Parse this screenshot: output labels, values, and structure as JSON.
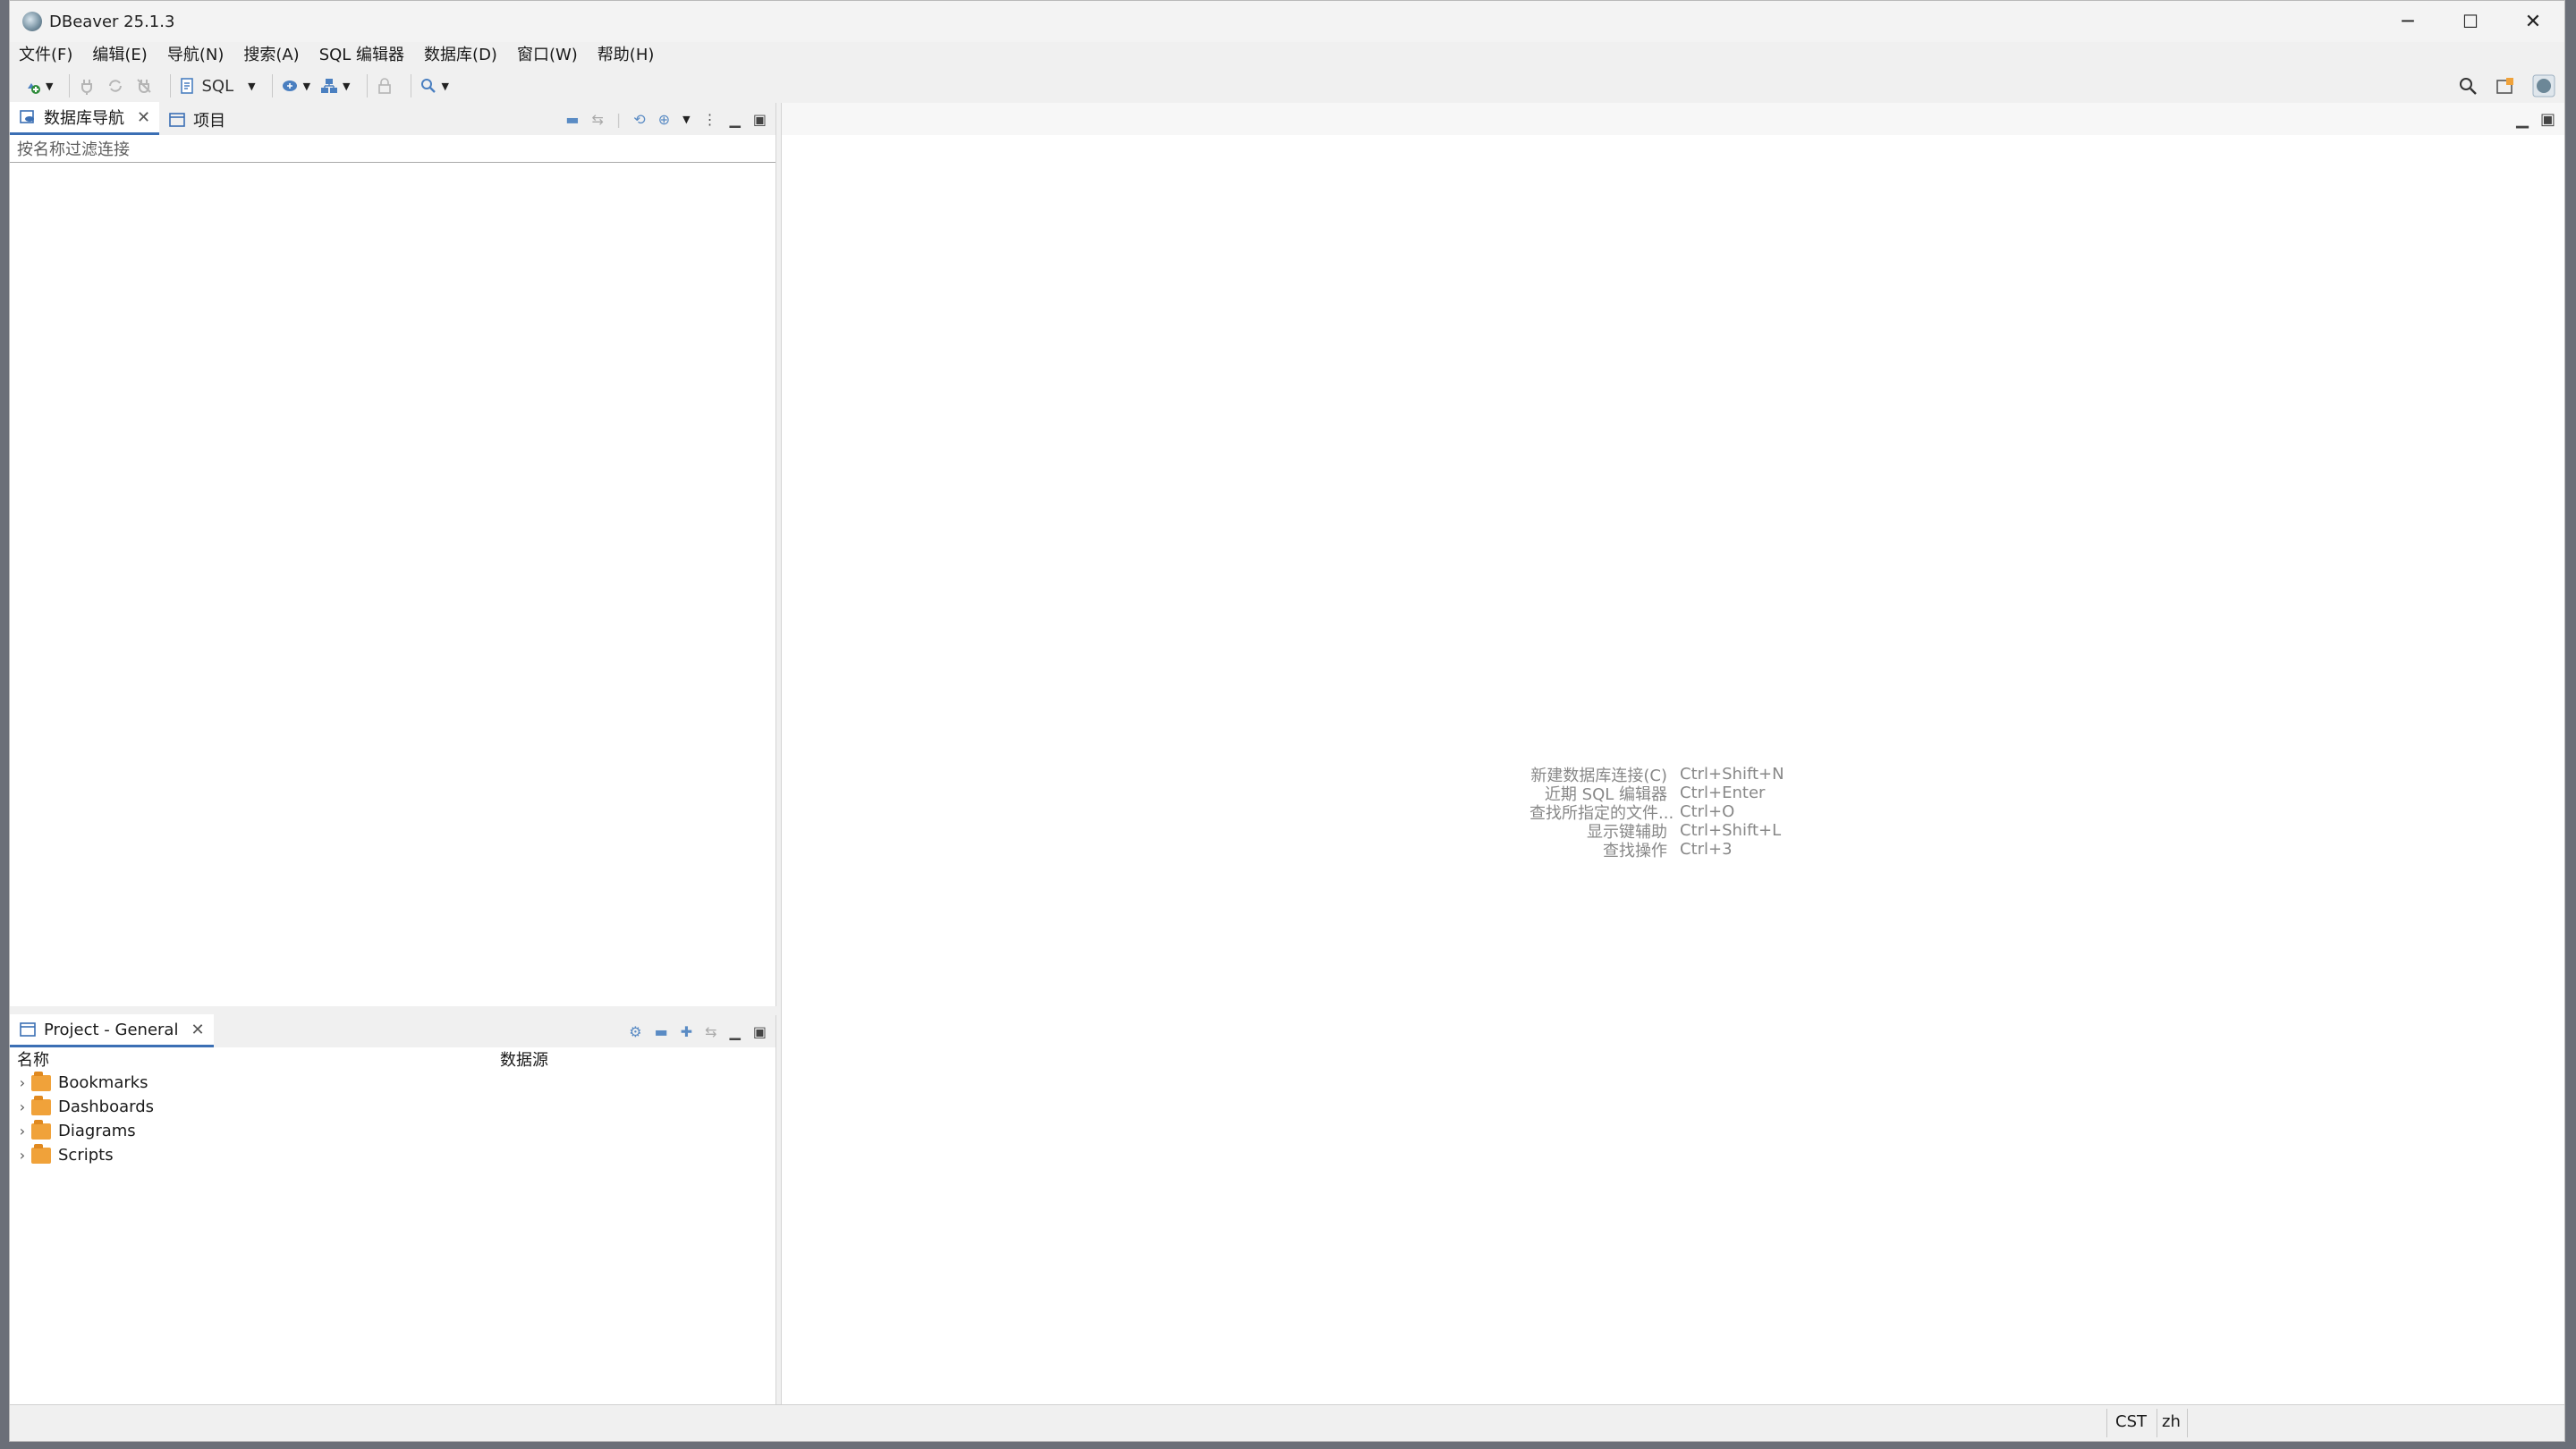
{
  "window": {
    "title": "DBeaver 25.1.3",
    "controls": {
      "minimize": "─",
      "maximize": "☐",
      "close": "✕"
    }
  },
  "menubar": [
    "文件(F)",
    "编辑(E)",
    "导航(N)",
    "搜索(A)",
    "SQL 编辑器",
    "数据库(D)",
    "窗口(W)",
    "帮助(H)"
  ],
  "toolbar": {
    "sql_label": "SQL"
  },
  "navigator": {
    "tabs": [
      {
        "label": "数据库导航",
        "active": true,
        "closable": true
      },
      {
        "label": "项目",
        "active": false,
        "closable": false
      }
    ],
    "filter_placeholder": "按名称过滤连接"
  },
  "project": {
    "tab_label": "Project - General",
    "columns": [
      "名称",
      "数据源"
    ],
    "items": [
      "Bookmarks",
      "Dashboards",
      "Diagrams",
      "Scripts"
    ]
  },
  "editor_hints": [
    {
      "label": "新建数据库连接(C)",
      "key": "Ctrl+Shift+N"
    },
    {
      "label": "近期 SQL 编辑器",
      "key": "Ctrl+Enter"
    },
    {
      "label": "查找所指定的文件...",
      "key": "Ctrl+O"
    },
    {
      "label": "显示键辅助",
      "key": "Ctrl+Shift+L"
    },
    {
      "label": "查找操作",
      "key": "Ctrl+3"
    }
  ],
  "status": {
    "timezone": "CST",
    "locale": "zh"
  },
  "colors": {
    "accent": "#3b6fb4",
    "folder": "#f0a23a"
  }
}
